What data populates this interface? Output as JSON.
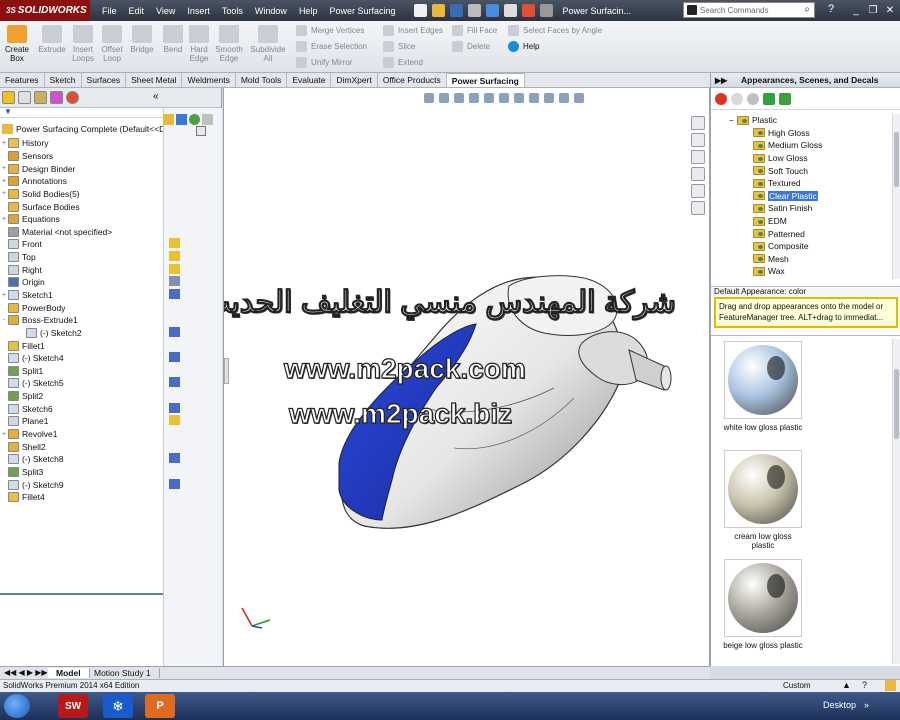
{
  "app": {
    "logo": "SOLIDWORKS",
    "logo_prefix": "3S",
    "menu": [
      "File",
      "Edit",
      "View",
      "Insert",
      "Tools",
      "Window",
      "Help",
      "Power Surfacing"
    ],
    "doc_title": "Power Surfacin...",
    "search_placeholder": "Search Commands"
  },
  "ribbon": {
    "buttons": [
      {
        "label": "Create Box",
        "active": true
      },
      {
        "label": "Extrude",
        "active": false
      },
      {
        "label": "Insert Loops",
        "active": false
      },
      {
        "label": "Offset Loop",
        "active": false
      },
      {
        "label": "Bridge",
        "active": false
      },
      {
        "label": "Bend",
        "active": false
      },
      {
        "label": "Hard Edge",
        "active": false
      },
      {
        "label": "Smooth Edge",
        "active": false
      },
      {
        "label": "Subdivide All",
        "active": false
      }
    ],
    "small": [
      {
        "label": "Merge Vertices",
        "active": false
      },
      {
        "label": "Erase Selection",
        "active": false
      },
      {
        "label": "Unify Mirror",
        "active": false
      },
      {
        "label": "Insert Edges",
        "active": false
      },
      {
        "label": "Slice",
        "active": false
      },
      {
        "label": "Extend",
        "active": false
      },
      {
        "label": "Fill Face",
        "active": false
      },
      {
        "label": "Delete",
        "active": false
      },
      {
        "label": "Select Faces by Angle",
        "active": false
      },
      {
        "label": "Help",
        "active": true
      }
    ]
  },
  "tabs": [
    "Features",
    "Sketch",
    "Surfaces",
    "Sheet Metal",
    "Weldments",
    "Mold Tools",
    "Evaluate",
    "DimXpert",
    "Office Products",
    "Power Surfacing"
  ],
  "active_tab": "Power Surfacing",
  "feature_tree": {
    "root": "Power Surfacing Complete  (Default<<D",
    "items": [
      {
        "label": "History",
        "icon": "folder-icon",
        "expand": "+"
      },
      {
        "label": "Sensors",
        "icon": "sensor-icon",
        "expand": ""
      },
      {
        "label": "Design Binder",
        "icon": "binder-icon",
        "expand": "+"
      },
      {
        "label": "Annotations",
        "icon": "annotation-icon",
        "expand": "+"
      },
      {
        "label": "Solid Bodies(5)",
        "icon": "solid-bodies-icon",
        "expand": "+"
      },
      {
        "label": "Surface Bodies",
        "icon": "surface-bodies-icon",
        "expand": ""
      },
      {
        "label": "Equations",
        "icon": "equations-icon",
        "expand": "+"
      },
      {
        "label": "Material <not specified>",
        "icon": "material-icon",
        "expand": ""
      },
      {
        "label": "Front",
        "icon": "plane-icon",
        "expand": ""
      },
      {
        "label": "Top",
        "icon": "plane-icon",
        "expand": ""
      },
      {
        "label": "Right",
        "icon": "plane-icon",
        "expand": ""
      },
      {
        "label": "Origin",
        "icon": "origin-icon",
        "expand": ""
      },
      {
        "label": "Sketch1",
        "icon": "sketch-icon",
        "expand": "+"
      },
      {
        "label": "PowerBody",
        "icon": "power-body-icon",
        "expand": ""
      },
      {
        "label": "Boss-Extrude1",
        "icon": "extrude-icon",
        "expand": "-"
      },
      {
        "label": "(-) Sketch2",
        "icon": "sketch-icon",
        "expand": "",
        "indent": true
      },
      {
        "label": "Fillet1",
        "icon": "fillet-icon",
        "expand": ""
      },
      {
        "label": "(-) Sketch4",
        "icon": "sketch-icon",
        "expand": ""
      },
      {
        "label": "Split1",
        "icon": "split-icon",
        "expand": ""
      },
      {
        "label": "(-) Sketch5",
        "icon": "sketch-icon",
        "expand": ""
      },
      {
        "label": "Split2",
        "icon": "split-icon",
        "expand": ""
      },
      {
        "label": "Sketch6",
        "icon": "sketch-icon",
        "expand": ""
      },
      {
        "label": "Plane1",
        "icon": "plane-icon",
        "expand": ""
      },
      {
        "label": "Revolve1",
        "icon": "revolve-icon",
        "expand": "+"
      },
      {
        "label": "Shell2",
        "icon": "shell-icon",
        "expand": ""
      },
      {
        "label": "(-) Sketch8",
        "icon": "sketch-icon",
        "expand": ""
      },
      {
        "label": "Split3",
        "icon": "split-icon",
        "expand": ""
      },
      {
        "label": "(-) Sketch9",
        "icon": "sketch-icon",
        "expand": ""
      },
      {
        "label": "Fillet4",
        "icon": "fillet-icon",
        "expand": ""
      }
    ]
  },
  "appearances": {
    "header": "Appearances, Scenes, and Decals",
    "parent": "Plastic",
    "items": [
      "High Gloss",
      "Medium Gloss",
      "Low Gloss",
      "Soft Touch",
      "Textured",
      "Clear Plastic",
      "Satin Finish",
      "EDM",
      "Patterned",
      "Composite",
      "Mesh",
      "Wax"
    ],
    "selected": "Clear Plastic",
    "default_label": "Default Appearance: color",
    "tooltip": "Drag and drop appearances onto the model or FeatureManager tree.  ALT+drag to immediat...",
    "swatches": [
      {
        "label": "white low gloss plastic",
        "color": "#a9c4e0"
      },
      {
        "label": "cream low gloss plastic",
        "color": "#c9c4ad"
      },
      {
        "label": "beige low gloss plastic",
        "color": "#aaa79d"
      }
    ]
  },
  "watermarks": [
    "شركة المهندس منسي التغليف الحديث",
    "www.m2pack.com",
    "www.m2pack.biz"
  ],
  "bottom_tabs": [
    "Model",
    "Motion Study 1"
  ],
  "status": {
    "edition": "SolidWorks Premium 2014 x64 Edition",
    "units": "Custom"
  },
  "taskbar": {
    "desktop": "Desktop"
  },
  "colors": {
    "model_blue": "#1f3bc8",
    "selection": "#3a78d8",
    "logo_red": "#8b1010",
    "tooltip_border": "#e8b800"
  }
}
